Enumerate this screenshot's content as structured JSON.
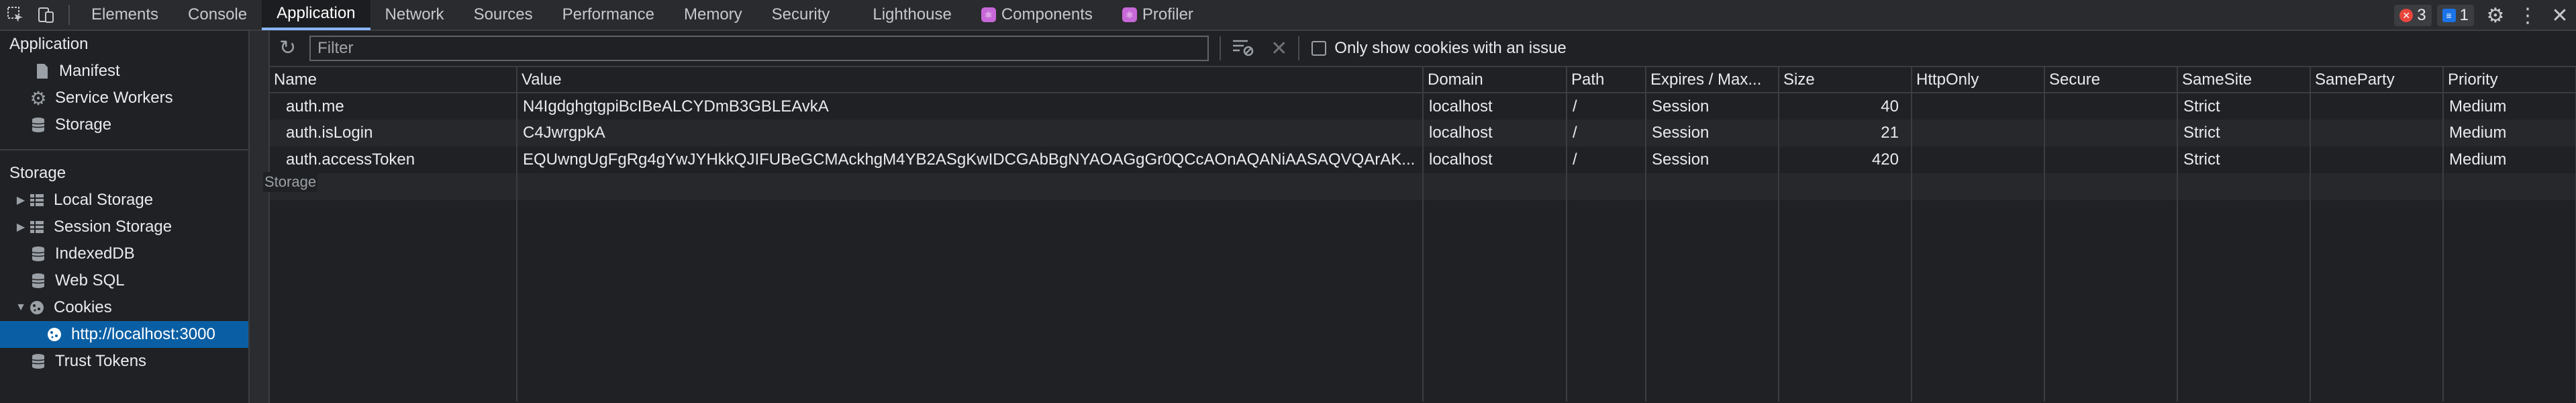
{
  "toolbar_tabs": [
    {
      "label": "Elements"
    },
    {
      "label": "Console"
    },
    {
      "label": "Application"
    },
    {
      "label": "Network"
    },
    {
      "label": "Sources"
    },
    {
      "label": "Performance"
    },
    {
      "label": "Memory"
    },
    {
      "label": "Security"
    },
    {
      "label": "Lighthouse"
    },
    {
      "label": "Components"
    },
    {
      "label": "Profiler"
    }
  ],
  "status": {
    "errors": "3",
    "messages": "1"
  },
  "sidebar": {
    "app_header": "Application",
    "app_items": [
      {
        "label": "Manifest",
        "icon": "file-icon"
      },
      {
        "label": "Service Workers",
        "icon": "gear-icon"
      },
      {
        "label": "Storage",
        "icon": "database-icon"
      }
    ],
    "storage_header": "Storage",
    "storage_items": [
      {
        "label": "Local Storage",
        "icon": "grid-icon",
        "expandable": true
      },
      {
        "label": "Session Storage",
        "icon": "grid-icon",
        "expandable": true
      },
      {
        "label": "IndexedDB",
        "icon": "database-icon"
      },
      {
        "label": "Web SQL",
        "icon": "database-icon"
      },
      {
        "label": "Cookies",
        "icon": "cookie-icon",
        "expanded": true
      },
      {
        "label": "http://localhost:3000",
        "icon": "cookie-icon",
        "selected": true
      },
      {
        "label": "Trust Tokens",
        "icon": "database-icon"
      }
    ]
  },
  "main": {
    "filter_placeholder": "Filter",
    "issue_checkbox_label": "Only show cookies with an issue",
    "tooltip": "Storage"
  },
  "table": {
    "columns": [
      "Name",
      "Value",
      "Domain",
      "Path",
      "Expires / Max...",
      "Size",
      "HttpOnly",
      "Secure",
      "SameSite",
      "SameParty",
      "Priority"
    ],
    "rows": [
      {
        "name": "auth.me",
        "value": "N4IgdghgtgpiBcIBeALCYDmB3GBLEAvkA",
        "domain": "localhost",
        "path": "/",
        "expires": "Session",
        "size": "40",
        "httponly": "",
        "secure": "",
        "samesite": "Strict",
        "sameparty": "",
        "priority": "Medium"
      },
      {
        "name": "auth.isLogin",
        "value": "C4JwrgpkA",
        "domain": "localhost",
        "path": "/",
        "expires": "Session",
        "size": "21",
        "httponly": "",
        "secure": "",
        "samesite": "Strict",
        "sameparty": "",
        "priority": "Medium"
      },
      {
        "name": "auth.accessToken",
        "value": "EQUwngUgFgRg4gYwJYHkkQJIFUBeGCMAckhgM4YB2ASgKwIDCGAbBgNYAOAGgGr0QCcAOnAQANiAASAQVQArAK...",
        "domain": "localhost",
        "path": "/",
        "expires": "Session",
        "size": "420",
        "httponly": "",
        "secure": "",
        "samesite": "Strict",
        "sameparty": "",
        "priority": "Medium"
      }
    ]
  },
  "colors": {
    "accent": "#8ab4f8",
    "selected": "#0a5fa4",
    "error": "#e8453c",
    "info": "#1a73e8",
    "component_icon": "#c768d8"
  }
}
